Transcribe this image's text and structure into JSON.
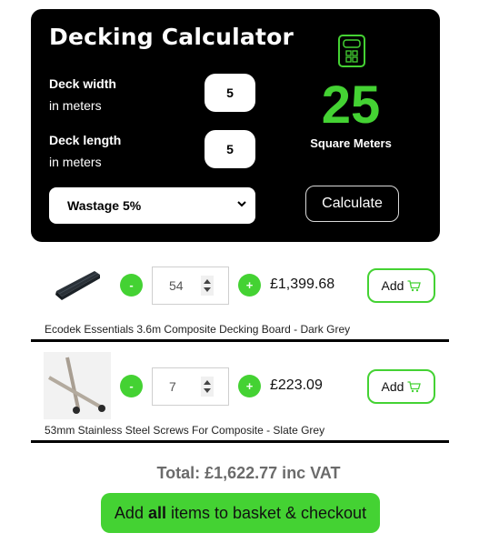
{
  "calculator": {
    "title": "Decking Calculator",
    "width_field": {
      "label": "Deck width",
      "sublabel": "in meters",
      "value": "5"
    },
    "length_field": {
      "label": "Deck length",
      "sublabel": "in meters",
      "value": "5"
    },
    "wastage_select": {
      "selected": "Wastage 5%"
    },
    "result": {
      "value": "25",
      "unit": "Square Meters"
    },
    "calculate_label": "Calculate",
    "icon": "calculator-icon",
    "accent_color": "#44d233"
  },
  "products": [
    {
      "name": "Ecodek Essentials 3.6m Composite Decking Board - Dark Grey",
      "quantity": "54",
      "price": "£1,399.68",
      "add_label": "Add",
      "minus_label": "-",
      "plus_label": "+",
      "image": "decking-board-image"
    },
    {
      "name": "53mm Stainless Steel Screws For Composite - Slate Grey",
      "quantity": "7",
      "price": "£223.09",
      "add_label": "Add",
      "minus_label": "-",
      "plus_label": "+",
      "image": "screws-image"
    }
  ],
  "summary": {
    "total": "Total: £1,622.77 inc VAT",
    "checkout_pre": "Add ",
    "checkout_bold": "all",
    "checkout_post": " items to basket & checkout"
  }
}
